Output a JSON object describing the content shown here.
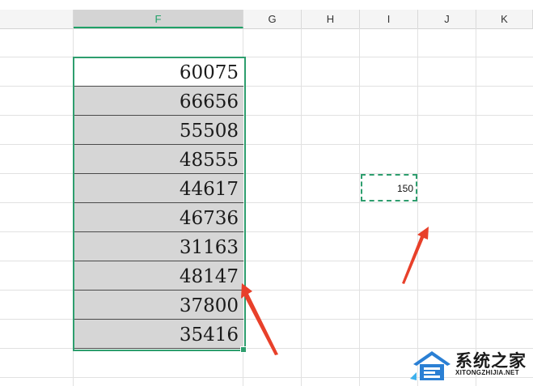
{
  "columns": {
    "f": "F",
    "g": "G",
    "h": "H",
    "i": "I",
    "j": "J",
    "k": "K"
  },
  "column_f_values": [
    "60075",
    "66656",
    "55508",
    "48555",
    "44617",
    "46736",
    "31163",
    "48147",
    "37800",
    "35416"
  ],
  "copied_cell": {
    "column": "I",
    "value": "150"
  },
  "colors": {
    "selection": "#2e9e6e",
    "shaded_cell": "#d6d6d6",
    "annotation_arrow": "#e8402a"
  },
  "icons": [
    "red-arrow-icon",
    "house-logo-icon"
  ],
  "watermark": {
    "title": "系统之家",
    "subtitle": "XITONGZHIJIA.NET"
  }
}
